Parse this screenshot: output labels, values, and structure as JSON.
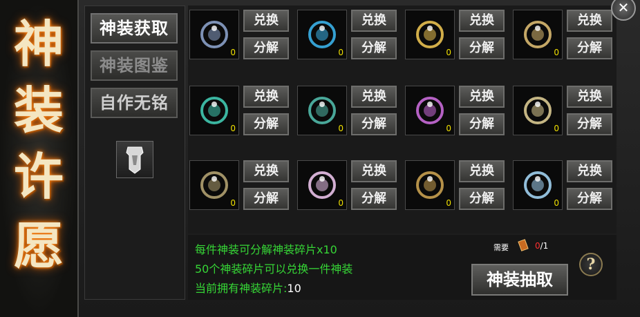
{
  "title_chars": [
    "神",
    "装",
    "许",
    "愿"
  ],
  "tabs": [
    {
      "label": "神装获取",
      "state": "active"
    },
    {
      "label": "神装图鉴",
      "state": "dim"
    },
    {
      "label": "自作无铭",
      "state": "normal"
    }
  ],
  "items": [
    {
      "icon": "helmet-icon",
      "count": "0",
      "color": "#8aa0c8",
      "exchange": "兑换",
      "decompose": "分解"
    },
    {
      "icon": "necklace-icon",
      "count": "0",
      "color": "#3ab0e8",
      "exchange": "兑换",
      "decompose": "分解"
    },
    {
      "icon": "gold-ring-icon",
      "count": "0",
      "color": "#e8c050",
      "exchange": "兑换",
      "decompose": "分解"
    },
    {
      "icon": "belt-icon",
      "count": "0",
      "color": "#d8b870",
      "exchange": "兑换",
      "decompose": "分解"
    },
    {
      "icon": "bracelet-icon",
      "count": "0",
      "color": "#40c8b0",
      "exchange": "兑换",
      "decompose": "分解"
    },
    {
      "icon": "boots-icon",
      "count": "0",
      "color": "#50b8a8",
      "exchange": "兑换",
      "decompose": "分解"
    },
    {
      "icon": "crown-icon",
      "count": "0",
      "color": "#c86ad8",
      "exchange": "兑换",
      "decompose": "分解"
    },
    {
      "icon": "chain-icon",
      "count": "0",
      "color": "#d8c890",
      "exchange": "兑换",
      "decompose": "分解"
    },
    {
      "icon": "skull-amulet-icon",
      "count": "0",
      "color": "#b0a070",
      "exchange": "兑换",
      "decompose": "分解"
    },
    {
      "icon": "gem-ring-icon",
      "count": "0",
      "color": "#e8c0e8",
      "exchange": "兑换",
      "decompose": "分解"
    },
    {
      "icon": "dragon-ring-icon",
      "count": "0",
      "color": "#c8a050",
      "exchange": "兑换",
      "decompose": "分解"
    },
    {
      "icon": "jewel-icon",
      "count": "0",
      "color": "#a0d0f0",
      "exchange": "兑换",
      "decompose": "分解"
    }
  ],
  "info": {
    "line1": "每件神装可分解神装碎片x10",
    "line2": "50个神装碎片可以兑换一件神装",
    "line3_label": "当前拥有神装碎片:",
    "line3_value": "10",
    "need_label": "需要",
    "need_have": "0",
    "need_total": "/1",
    "draw_label": "神装抽取",
    "help_label": "?",
    "close_label": "✕"
  }
}
